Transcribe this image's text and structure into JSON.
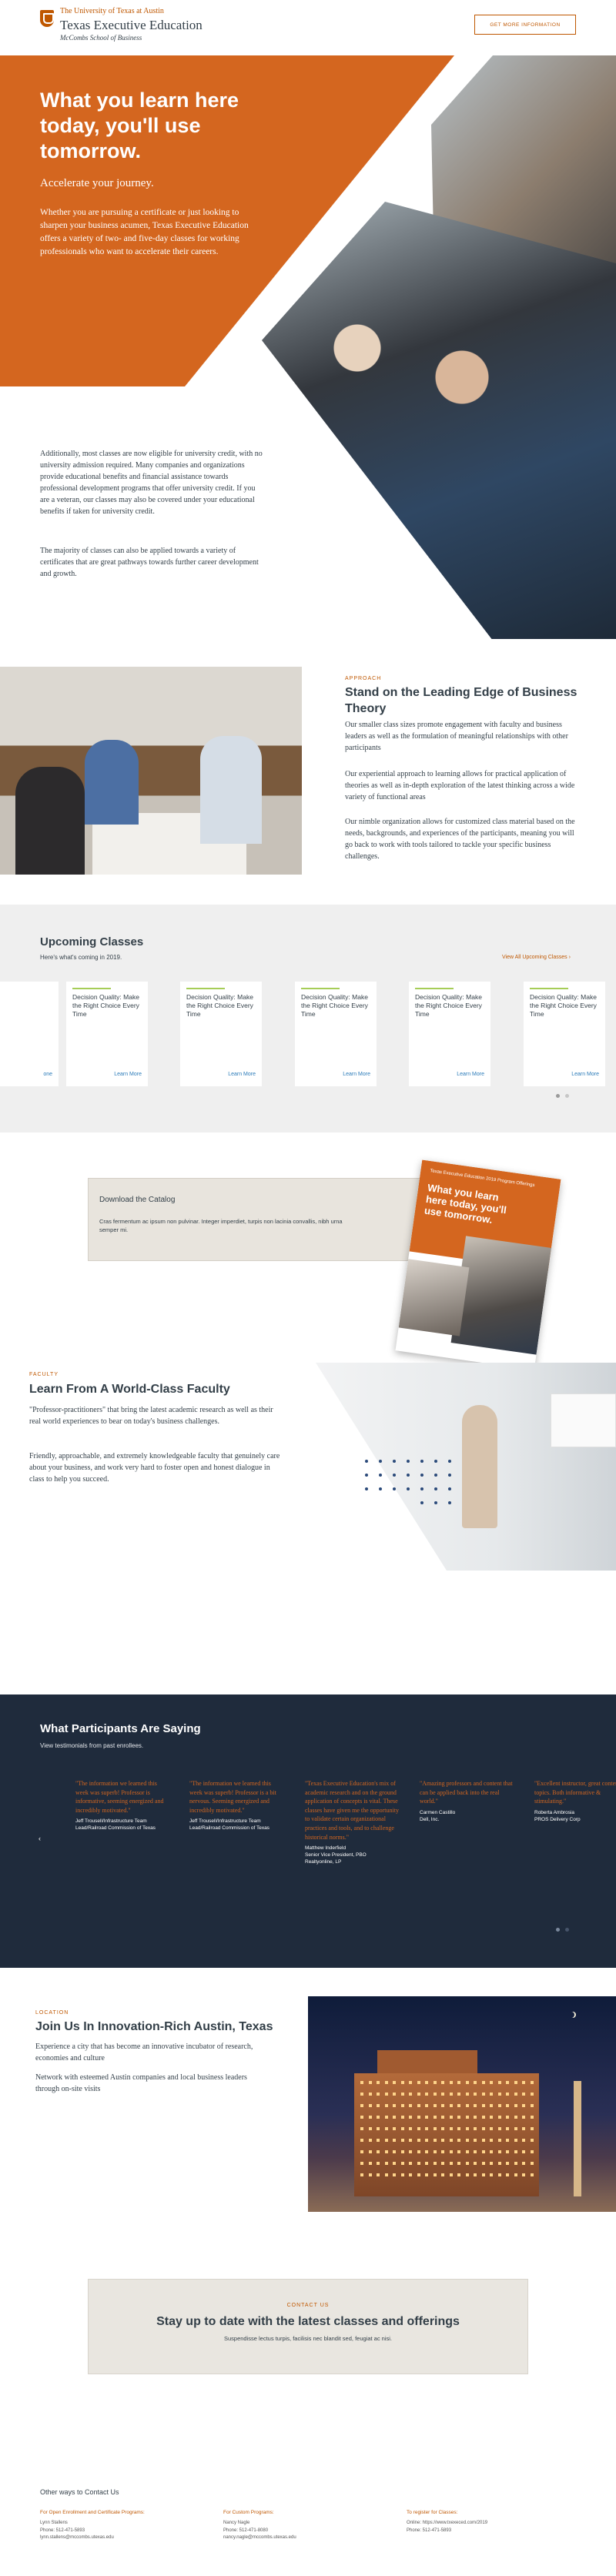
{
  "header": {
    "logo_line1": "The University of Texas at Austin",
    "logo_line2": "Texas Executive Education",
    "logo_line3": "McCombs School of Business",
    "cta_label": "GET MORE INFORMATION"
  },
  "hero": {
    "title": "What you learn here today, you'll use tomorrow.",
    "subtitle": "Accelerate your journey.",
    "intro": "Whether you are pursuing a certificate or just looking to sharpen your business acumen, Texas Executive Education offers a variety of two- and five-day classes for working professionals who want to accelerate their careers.",
    "para2": "Additionally, most classes are now eligible for university credit, with no university admission required. Many companies and organizations provide educational benefits and financial assistance towards professional development programs that offer university credit. If you are a veteran, our classes may also be covered under your educational benefits if taken for university credit.",
    "para3": "The majority of classes can also be applied towards a variety of certificates that are great pathways towards further career development and growth."
  },
  "approach": {
    "eyebrow": "APPROACH",
    "title": "Stand on the Leading Edge of Business Theory",
    "p1": "Our smaller class sizes promote engagement with faculty and business leaders as well as the formulation of meaningful relationships with other participants",
    "p2": "Our experiential approach to learning allows for practical application of theories as well as in-depth exploration of the latest thinking across a wide variety of functional areas",
    "p3": "Our nimble organization allows for customized class material based on the needs, backgrounds, and experiences of the participants, meaning you will go back to work with tools tailored to tackle your specific business challenges."
  },
  "upcoming": {
    "title": "Upcoming Classes",
    "subtitle": "Here's what's coming in 2019.",
    "view_all": "View All Upcoming Classes ›",
    "partial_link": "one",
    "cards": [
      {
        "title": "Decision Quality: Make the Right Choice Every Time",
        "link": "Learn More"
      },
      {
        "title": "Decision Quality: Make the Right Choice Every Time",
        "link": "Learn More"
      },
      {
        "title": "Decision Quality: Make the Right Choice Every Time",
        "link": "Learn More"
      },
      {
        "title": "Decision Quality: Make the Right Choice Every Time",
        "link": "Learn More"
      },
      {
        "title": "Decision Quality: Make the Right Choice Every Time",
        "link": "Learn More"
      }
    ]
  },
  "catalog": {
    "title": "Download the Catalog",
    "body": "Cras fermentum ac ipsum non pulvinar. Integer imperdiet, turpis non lacinia convallis, nibh urna semper mi.",
    "cover_kicker": "Texas Executive Education 2019 Program Offerings",
    "cover_title": "What you learn here today, you'll use tomorrow."
  },
  "faculty": {
    "eyebrow": "FACULTY",
    "title": "Learn From A World-Class Faculty",
    "p1": "\"Professor-practitioners\" that bring the latest academic research as well as their real world experiences to bear on today's business challenges.",
    "p2": "Friendly, approachable, and extremely knowledgeable faculty that genuinely care about your business, and work very hard to foster open and honest dialogue in class to help you succeed."
  },
  "testimonials": {
    "title": "What Participants Are Saying",
    "subtitle": "View testimonials from past enrollees.",
    "prev_arrow": "‹",
    "items": [
      {
        "quote": "\"The information we learned this week was superb! Professor is informative, seeming energized and incredibly motivated.\"",
        "name": "Jeff Trousell/Infrastructure Team Lead/Railroad Commission of Texas"
      },
      {
        "quote": "\"The information we learned this week was superb! Professor is a bit nervous. Seeming energized and incredibly motivated.\"",
        "name": "Jeff Trousell/Infrastructure Team Lead/Railroad Commission of Texas"
      },
      {
        "quote": "\"Texas Executive Education's mix of academic research and on the ground application of concepts is vital. These classes have given me the opportunity to validate certain organizational practices and tools, and to challenge historical norms.\"",
        "name": "Matthew Inderfield\nSenior Vice President, PBO\nRealtyonline, LP"
      },
      {
        "quote": "\"Amazing professors and content that can be applied back into the real world.\"",
        "name": "Carmen Castillo\nDell, Inc."
      },
      {
        "quote": "\"Excellent instructor, great content, topics. Both informative & stimulating.\"",
        "name": "Roberta Ambrosia\nPROS Delivery Corp"
      }
    ]
  },
  "location": {
    "eyebrow": "LOCATION",
    "title": "Join Us In Innovation-Rich Austin, Texas",
    "p1": "Experience a city that has become an innovative incubator of research, economies and culture",
    "p2": "Network with esteemed Austin companies and local business leaders through on-site visits"
  },
  "contact": {
    "eyebrow": "CONTACT US",
    "title": "Stay up to date with the latest classes and offerings",
    "body": "Suspendisse lectus turpis, facilisis nec blandit sed, feugiat ac nisi."
  },
  "footer": {
    "title": "Other ways to Contact Us",
    "columns": [
      {
        "heading": "For Open Enrollment and Certificate Programs:",
        "line1": "Lynn Stallens",
        "line2": "Phone: 512-471-5893",
        "line3": "lynn.stallens@mccombs.utexas.edu"
      },
      {
        "heading": "For Custom Programs:",
        "line1": "Nancy Nagle",
        "line2": "Phone: 512-471-8080",
        "line3": "nancy.nagle@mccombs.utexas.edu"
      },
      {
        "heading": "To register for Classes:",
        "line1": "Online: https://www.txexeced.com/2019",
        "line2": "Phone: 512-471-5893",
        "line3": ""
      }
    ]
  },
  "colors": {
    "accent": "#bf5700",
    "hero_orange": "#d4661f",
    "navy": "#1f2b3c",
    "link_blue": "#2b7bb9"
  }
}
